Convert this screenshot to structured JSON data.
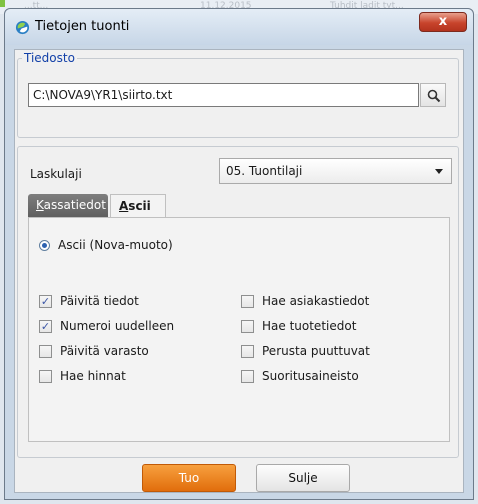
{
  "background": {
    "faint_text_1": "...tt...",
    "faint_text_2": "11.12.2015",
    "faint_text_3": "Tuhdit ladit tyt..."
  },
  "window": {
    "title": "Tietojen tuonti",
    "close_glyph": "x"
  },
  "file_section": {
    "legend": "Tiedosto",
    "path_value": "C:\\NOVA9\\YR1\\siirto.txt",
    "search_icon": "search-icon"
  },
  "settings": {
    "laskulaji_label": "Laskulaji",
    "laskulaji_value": "05. Tuontilaji",
    "tabs": [
      {
        "label_first": "K",
        "label_rest": "assatiedot",
        "active": false
      },
      {
        "label_first": "A",
        "label_rest": "scii",
        "active": true
      }
    ],
    "ascii_radio_label": "Ascii (Nova-muoto)",
    "checkboxes_left": [
      {
        "label": "Päivitä tiedot",
        "checked": true
      },
      {
        "label": "Numeroi uudelleen",
        "checked": true
      },
      {
        "label": "Päivitä varasto",
        "checked": false
      },
      {
        "label": "Hae hinnat",
        "checked": false
      }
    ],
    "checkboxes_right": [
      {
        "label": "Hae asiakastiedot",
        "checked": false
      },
      {
        "label": "Hae tuotetiedot",
        "checked": false
      },
      {
        "label": "Perusta puuttuvat",
        "checked": false
      },
      {
        "label": "Suoritusaineisto",
        "checked": false
      }
    ]
  },
  "buttons": {
    "tuo": "Tuo",
    "sulje": "Sulje"
  },
  "colors": {
    "accent_orange": "#e9821f",
    "legend_blue": "#1240a8",
    "close_red": "#c8442c"
  }
}
